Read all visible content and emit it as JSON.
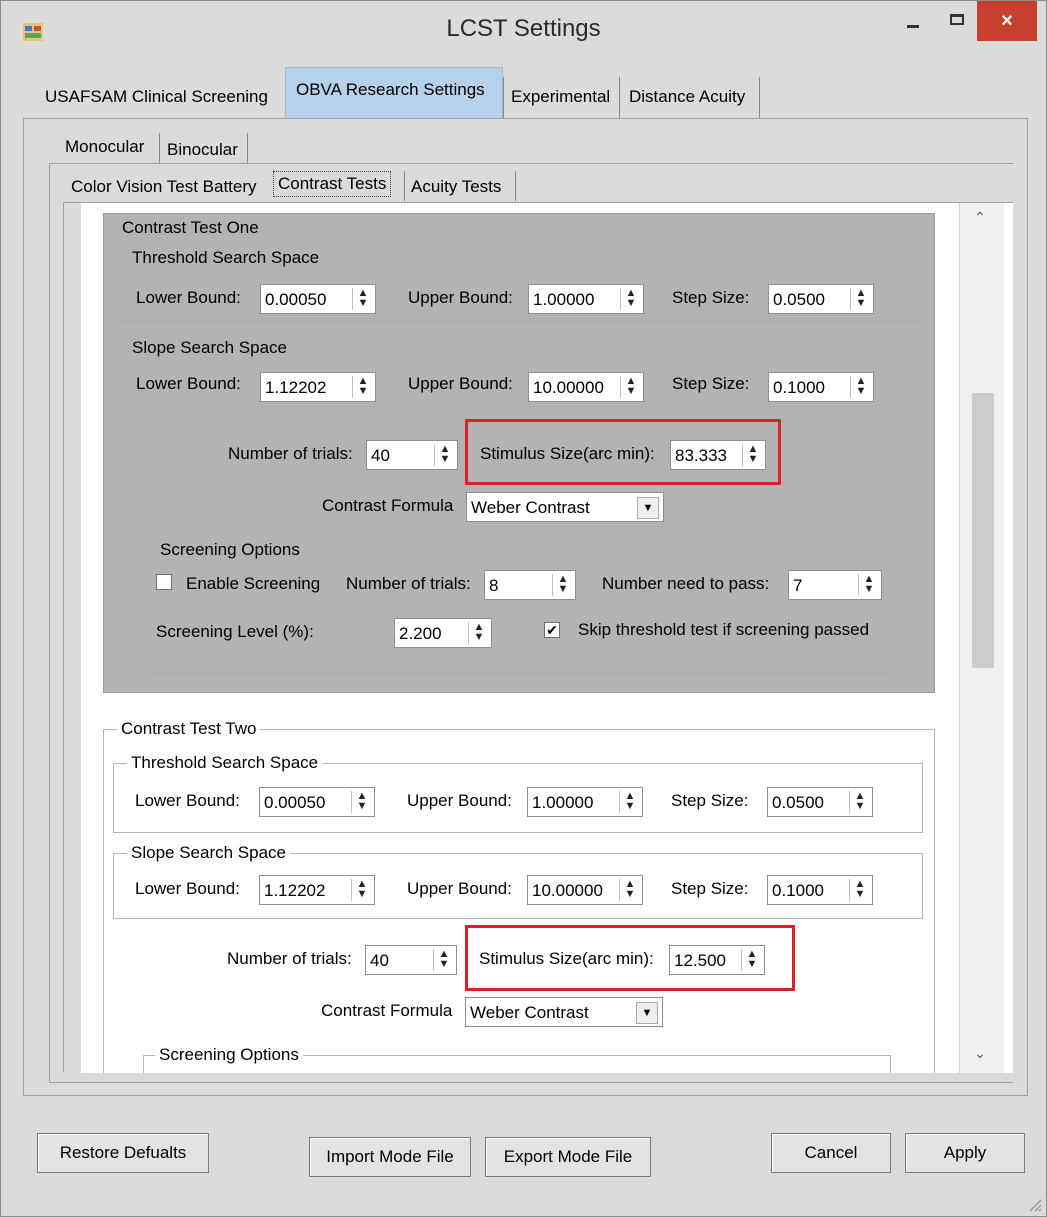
{
  "window": {
    "title": "LCST Settings",
    "close_glyph": "×"
  },
  "main_tabs": [
    "USAFSAM Clinical Screening",
    "OBVA Research Settings",
    "Experimental",
    "Distance Acuity"
  ],
  "eye_tabs": [
    "Monocular",
    "Binocular"
  ],
  "test_tabs": [
    "Color Vision Test Battery",
    "Contrast Tests",
    "Acuity Tests"
  ],
  "labels": {
    "threshold_space": "Threshold Search Space",
    "slope_space": "Slope Search Space",
    "lower_bound": "Lower Bound:",
    "upper_bound": "Upper Bound:",
    "step_size": "Step Size:",
    "num_trials": "Number of trials:",
    "stimulus_size": "Stimulus Size(arc min):",
    "contrast_formula": "Contrast Formula",
    "screening_options": "Screening Options",
    "enable_screening": "Enable Screening",
    "num_need_pass": "Number need to pass:",
    "screening_level": "Screening Level (%):",
    "skip_threshold": "Skip threshold test if screening passed"
  },
  "test_one": {
    "title": "Contrast Test One",
    "threshold": {
      "lower": "0.00050",
      "upper": "1.00000",
      "step": "0.0500"
    },
    "slope": {
      "lower": "1.12202",
      "upper": "10.00000",
      "step": "0.1000"
    },
    "trials": "40",
    "stimulus_size": "83.333",
    "formula": "Weber Contrast",
    "screening": {
      "enabled": false,
      "trials": "8",
      "need_pass": "7",
      "level": "2.200",
      "skip": true
    }
  },
  "test_two": {
    "title": "Contrast Test Two",
    "threshold": {
      "lower": "0.00050",
      "upper": "1.00000",
      "step": "0.0500"
    },
    "slope": {
      "lower": "1.12202",
      "upper": "10.00000",
      "step": "0.1000"
    },
    "trials": "40",
    "stimulus_size": "12.500",
    "formula": "Weber Contrast"
  },
  "buttons": {
    "restore": "Restore Defualts",
    "import": "Import Mode File",
    "export": "Export Mode File",
    "cancel": "Cancel",
    "apply": "Apply"
  },
  "colors": {
    "highlight": "#d8232a",
    "active_tab": "#b8d1ea",
    "close_button": "#c7402f"
  }
}
